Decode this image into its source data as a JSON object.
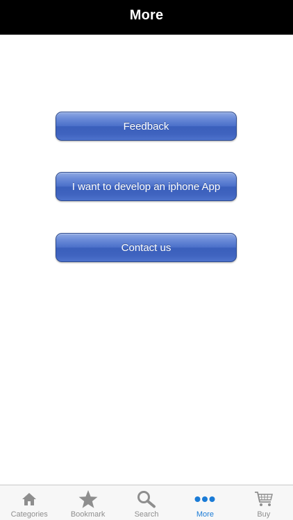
{
  "navbar": {
    "title": "More"
  },
  "actions": [
    {
      "label": "Feedback"
    },
    {
      "label": "I want to develop an iphone App"
    },
    {
      "label": "Contact us"
    }
  ],
  "tabbar": {
    "active": "More",
    "items": [
      {
        "label": "Categories",
        "icon": "home-icon"
      },
      {
        "label": "Bookmark",
        "icon": "star-icon"
      },
      {
        "label": "Search",
        "icon": "search-icon"
      },
      {
        "label": "More",
        "icon": "more-dots-icon"
      },
      {
        "label": "Buy",
        "icon": "cart-icon"
      }
    ]
  },
  "colors": {
    "navbar_bg": "#000000",
    "button_blue": "#4a6fc9",
    "tab_active": "#1a7bd6",
    "tab_inactive": "#8e8e8e"
  }
}
